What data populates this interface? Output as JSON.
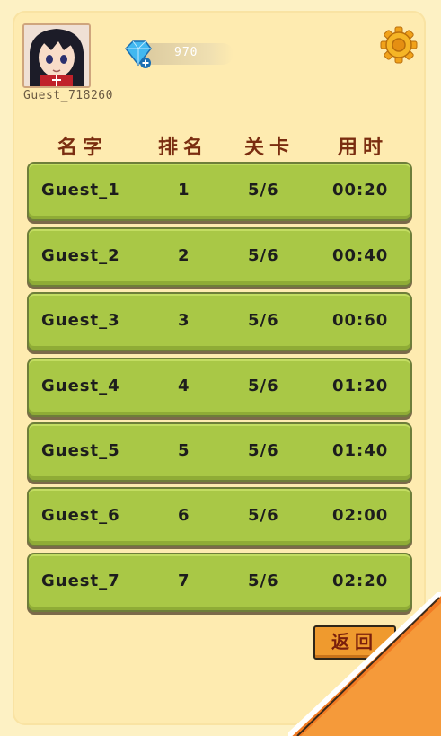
{
  "profile": {
    "username": "Guest_718260",
    "gem_count": "970"
  },
  "colors": {
    "row_green": "#a9c846",
    "header_brown": "#7a2d10",
    "button_orange": "#ef9a2e",
    "panel": "#feebb0"
  },
  "icons": {
    "settings": "gear-icon",
    "gem": "diamond-gem-icon",
    "add": "plus-icon"
  },
  "table": {
    "headers": [
      "名字",
      "排名",
      "关卡",
      "用时"
    ],
    "rows": [
      {
        "name": "Guest_1",
        "rank": "1",
        "level": "5/6",
        "time": "00:20"
      },
      {
        "name": "Guest_2",
        "rank": "2",
        "level": "5/6",
        "time": "00:40"
      },
      {
        "name": "Guest_3",
        "rank": "3",
        "level": "5/6",
        "time": "00:60"
      },
      {
        "name": "Guest_4",
        "rank": "4",
        "level": "5/6",
        "time": "01:20"
      },
      {
        "name": "Guest_5",
        "rank": "5",
        "level": "5/6",
        "time": "01:40"
      },
      {
        "name": "Guest_6",
        "rank": "6",
        "level": "5/6",
        "time": "02:00"
      },
      {
        "name": "Guest_7",
        "rank": "7",
        "level": "5/6",
        "time": "02:20"
      }
    ]
  },
  "back_label": "返回"
}
